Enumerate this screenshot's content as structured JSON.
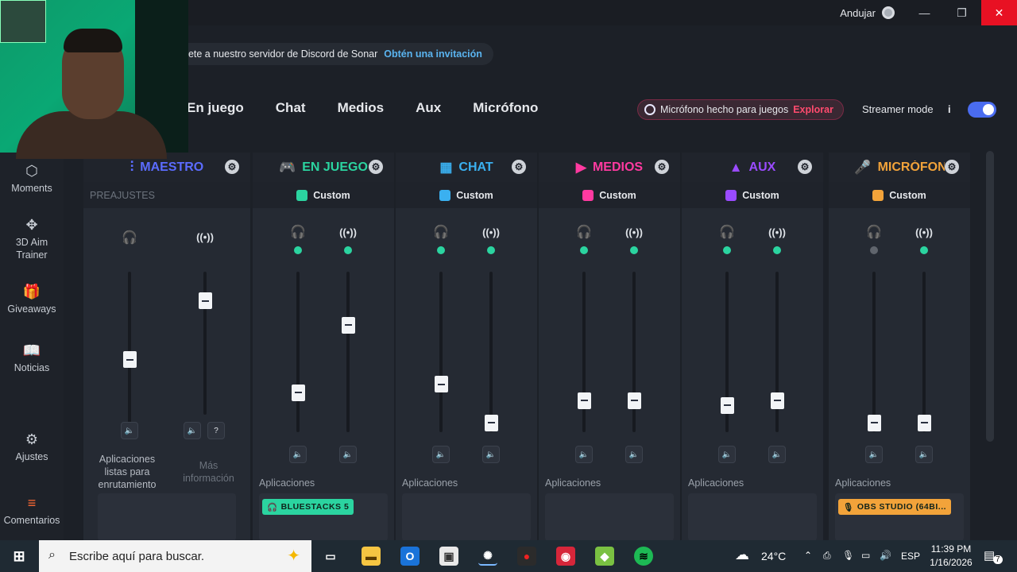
{
  "window": {
    "user": "Andujar",
    "minimize": "—",
    "maximize": "❐",
    "close": "✕"
  },
  "banner": {
    "text": "nete a nuestro servidor de Discord de Sonar",
    "link": "Obtén una invitación"
  },
  "tabs": [
    "En juego",
    "Chat",
    "Medios",
    "Aux",
    "Micrófono"
  ],
  "promo": {
    "text": "Micrófono hecho para juegos",
    "action": "Explorar"
  },
  "streamer_mode": {
    "label": "Streamer mode",
    "info": "i",
    "enabled": true
  },
  "sidebar": [
    {
      "label": "Moments",
      "icon": "⬡"
    },
    {
      "label": "3D Aim Trainer",
      "icon": "✥"
    },
    {
      "label": "Giveaways",
      "icon": "🎁"
    },
    {
      "label": "Noticias",
      "icon": "📖"
    },
    {
      "label": "Ajustes",
      "icon": "⚙"
    },
    {
      "label": "Comentarios",
      "icon": "≡"
    }
  ],
  "master": {
    "name": "MAESTRO",
    "color": "#5b6cff",
    "presets_label": "PREAJUSTES",
    "headphone_level": 0.45,
    "stream_level": 0.8,
    "routing_note": "Aplicaciones listas para enrutamiento",
    "more_info": "Más información"
  },
  "channels": [
    {
      "name": "EN JUEGO",
      "color": "#2bd4a0",
      "preset": "Custom",
      "headphone_level": 0.25,
      "stream_level": 0.67,
      "headphone_on": true,
      "stream_on": true,
      "apps_label": "Aplicaciones",
      "app_tag": "BLUESTACKS 5",
      "tag_color": "#2bd4a0"
    },
    {
      "name": "CHAT",
      "color": "#3ab0f0",
      "preset": "Custom",
      "headphone_level": 0.3,
      "stream_level": 0.06,
      "headphone_on": true,
      "stream_on": true,
      "apps_label": "Aplicaciones",
      "app_tag": "",
      "tag_color": ""
    },
    {
      "name": "MEDIOS",
      "color": "#ff3aa0",
      "preset": "Custom",
      "headphone_level": 0.2,
      "stream_level": 0.2,
      "headphone_on": true,
      "stream_on": true,
      "apps_label": "Aplicaciones",
      "app_tag": "",
      "tag_color": ""
    },
    {
      "name": "AUX",
      "color": "#9a4bff",
      "preset": "Custom",
      "headphone_level": 0.17,
      "stream_level": 0.2,
      "headphone_on": true,
      "stream_on": true,
      "apps_label": "Aplicaciones",
      "app_tag": "",
      "tag_color": ""
    },
    {
      "name": "MICRÓFONO",
      "color": "#f2a33a",
      "preset": "Custom",
      "headphone_level": 0.06,
      "stream_level": 0.06,
      "headphone_on": false,
      "stream_on": true,
      "apps_label": "Aplicaciones",
      "app_tag": "OBS STUDIO (64BI...",
      "tag_color": "#f2a33a"
    }
  ],
  "taskbar": {
    "search_placeholder": "Escribe aquí para buscar.",
    "weather": "24°C",
    "language": "ESP",
    "time": "11:39 PM",
    "date": "1/16/2026",
    "notifications": "7"
  }
}
